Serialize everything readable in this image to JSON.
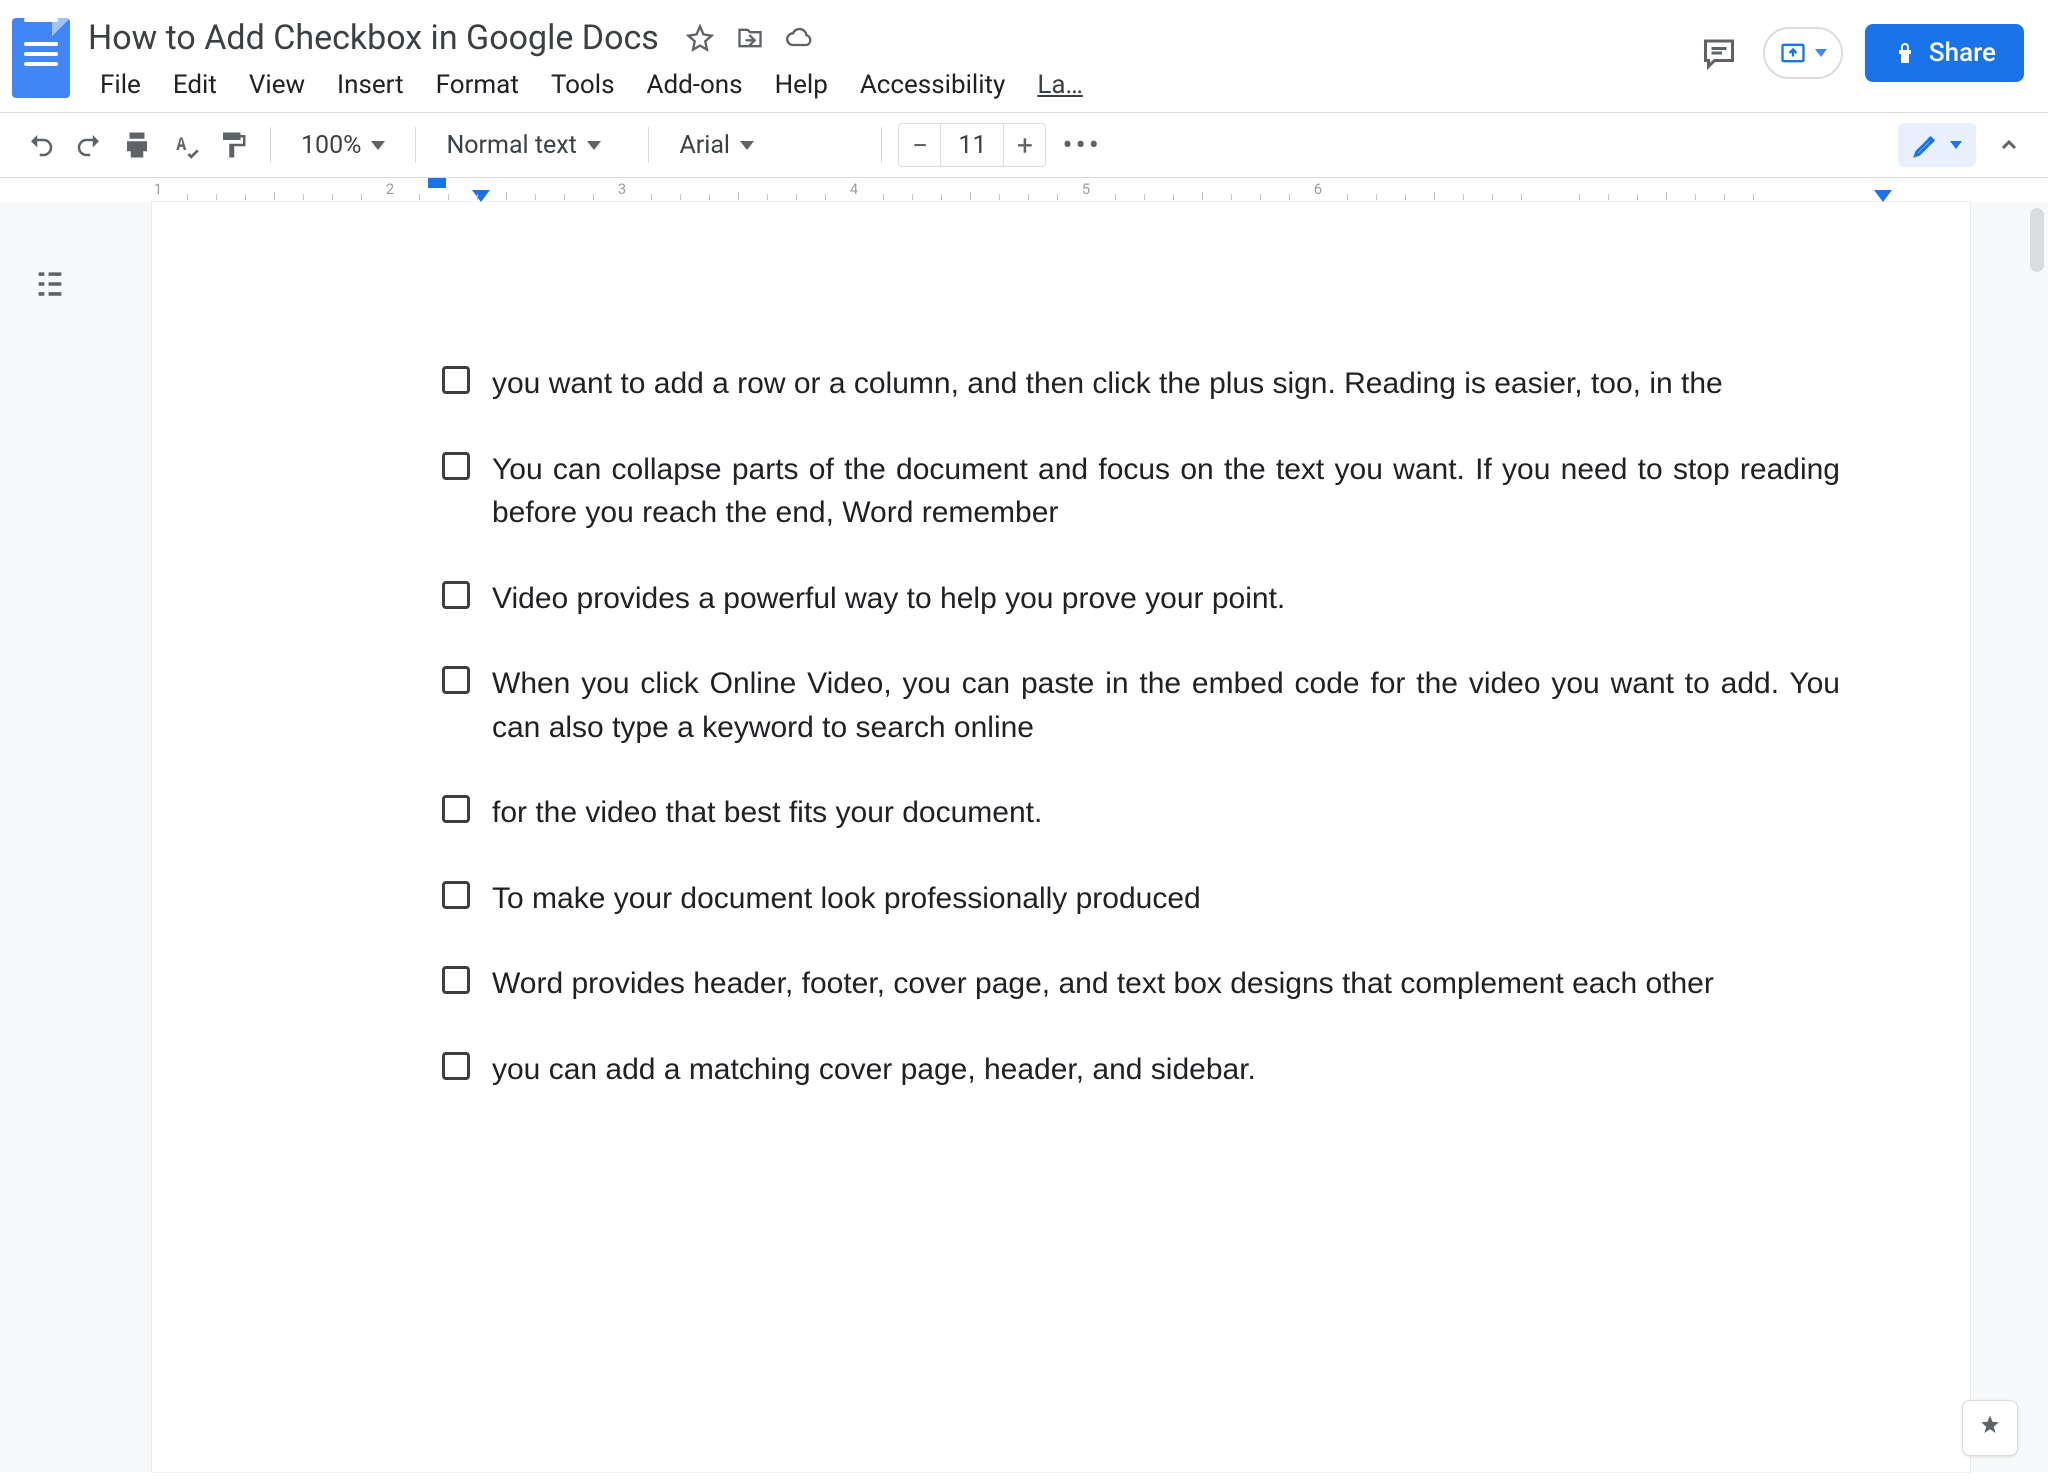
{
  "doc": {
    "title": "How to Add Checkbox in Google Docs"
  },
  "menus": {
    "file": "File",
    "edit": "Edit",
    "view": "View",
    "insert": "Insert",
    "format": "Format",
    "tools": "Tools",
    "addons": "Add-ons",
    "help": "Help",
    "accessibility": "Accessibility",
    "last": "La…"
  },
  "toolbar": {
    "zoom": "100%",
    "style": "Normal text",
    "font": "Arial",
    "fontsize": "11"
  },
  "share": {
    "label": "Share"
  },
  "checklist": [
    "you want to add a row or a column, and then click the plus sign. Reading is easier, too, in the",
    "You can collapse parts of the document and focus on the text you want. If you need to stop reading before you reach the end, Word remember",
    " Video provides a powerful way to help you prove your point.",
    "When you click Online Video, you can paste in the embed code for the video you want to add. You can also type a keyword to search online",
    " for the video that best fits your document.",
    "To make your document look professionally produced",
    " Word provides header, footer, cover page, and text box designs that complement each other",
    " you can add a matching cover page, header, and sidebar."
  ],
  "ruler": {
    "numbers": [
      "1",
      "2",
      "3",
      "4",
      "5",
      "6"
    ]
  }
}
